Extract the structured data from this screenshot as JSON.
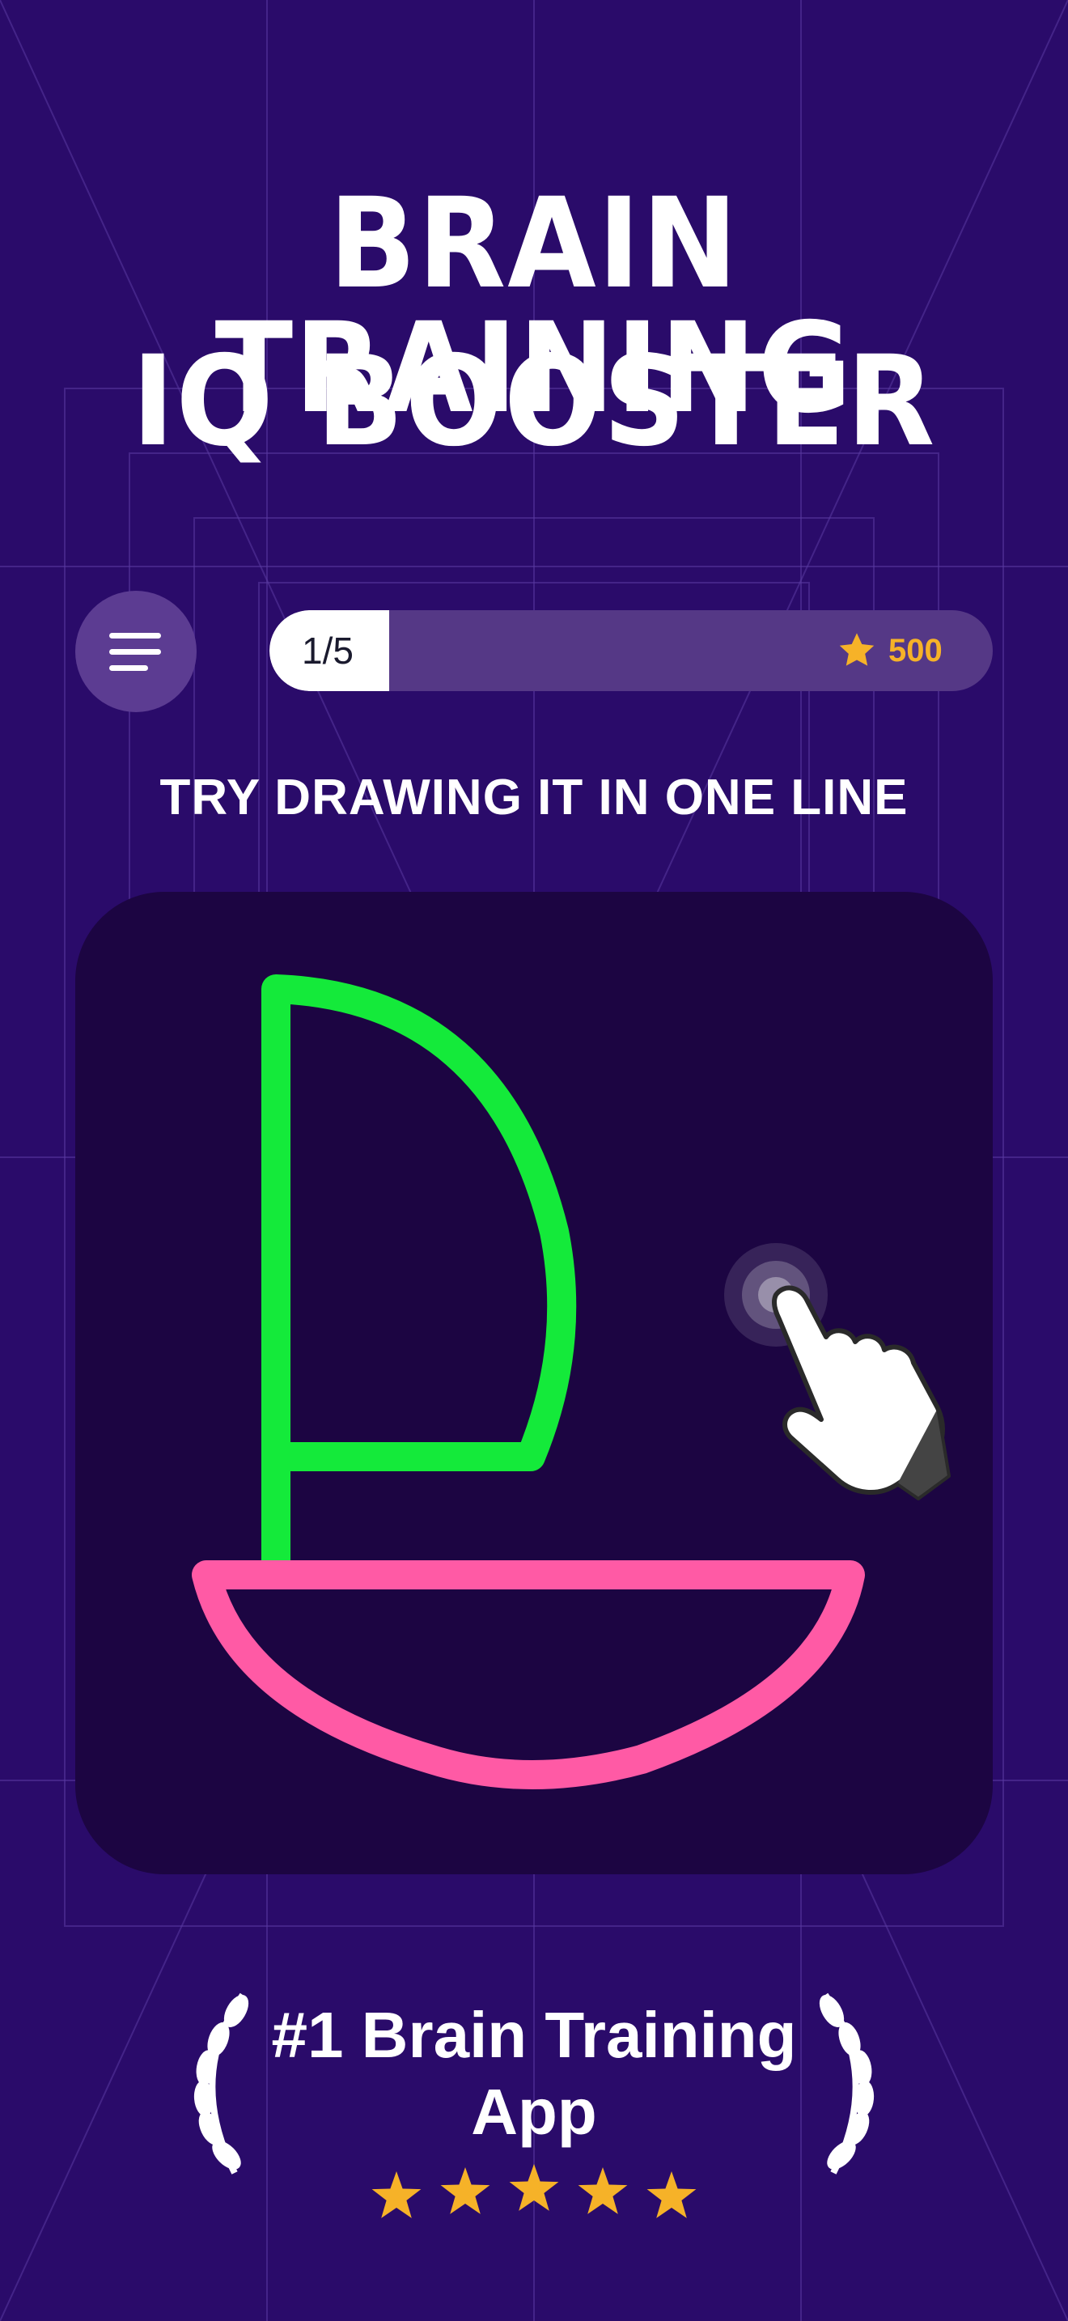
{
  "headline": {
    "line1": "BRAIN TRAINING",
    "line2": "IQ BOOSTER"
  },
  "toolbar": {
    "menu_icon": "hamburger-menu-icon",
    "progress_label": "1/5",
    "progress_fraction": 0.2,
    "score": "500",
    "score_icon": "star-icon"
  },
  "instruction": "TRY DRAWING IT IN ONE LINE",
  "puzzle": {
    "shape": "sailboat",
    "sail_color": "#14ea3a",
    "hull_color": "#ff5aa5",
    "hint_icon": "pointing-hand-icon"
  },
  "badge": {
    "line1": "#1 Brain Training",
    "line2": "App",
    "rating": 5,
    "star_color": "#f6b228",
    "decoration": "laurel-wreath-icon"
  },
  "colors": {
    "background": "#2a0b6a",
    "board": "#1c0542",
    "accent": "#f6b228"
  }
}
